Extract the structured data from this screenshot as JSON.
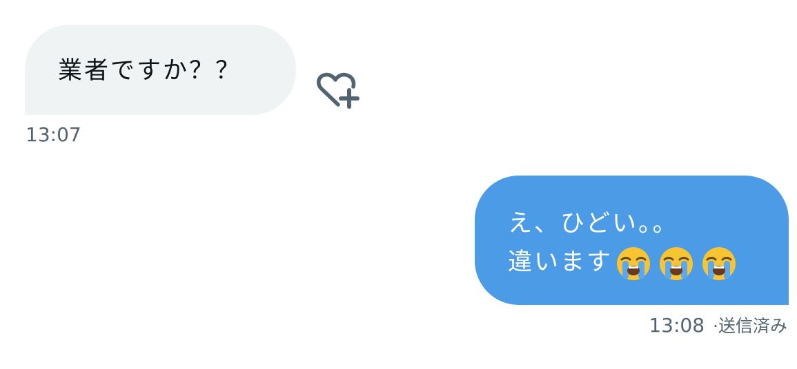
{
  "messages": {
    "incoming": {
      "text": "業者ですか？？",
      "time": "13:07",
      "reaction_icon": "heart-plus-icon"
    },
    "outgoing": {
      "line1": "え、ひどい。。",
      "line2": "違います",
      "emoji": [
        "loudly-crying-face",
        "loudly-crying-face",
        "loudly-crying-face"
      ],
      "time": "13:08",
      "status": "·送信済み"
    }
  },
  "colors": {
    "incoming_bubble": "#eff3f4",
    "outgoing_bubble": "#4b9be7",
    "meta_text": "#536471",
    "body_text": "#0f1419"
  }
}
